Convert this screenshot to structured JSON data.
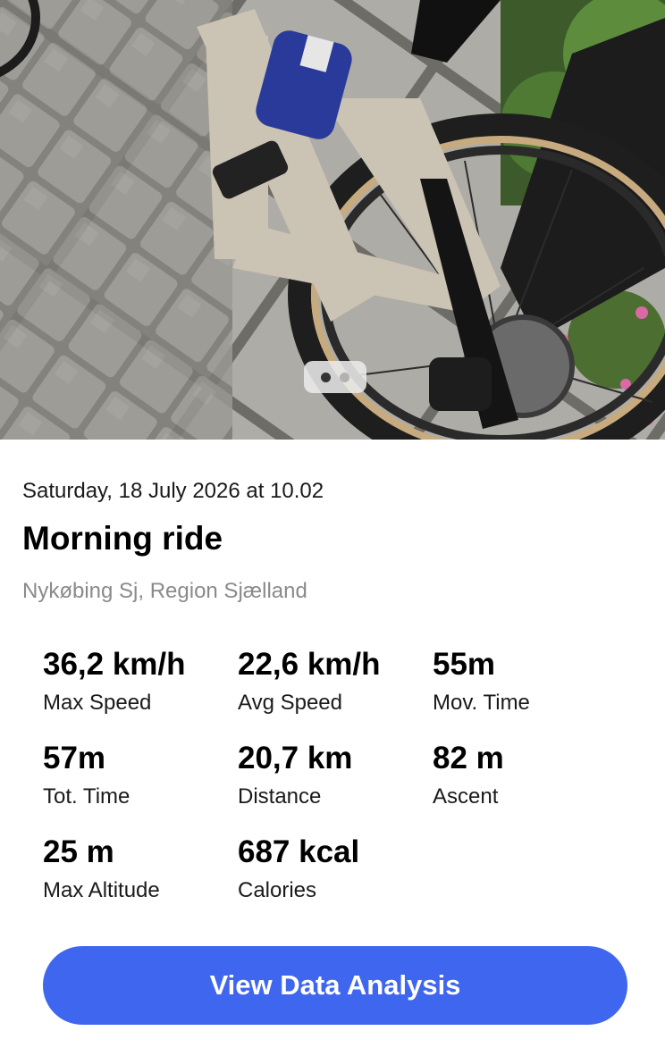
{
  "photo": {
    "alt_icon": "bicycle-photo",
    "pager": {
      "count": 2,
      "active_index": 0
    }
  },
  "activity": {
    "date_text": "Saturday, 18 July 2026 at 10.02",
    "title": "Morning ride",
    "location": "Nykøbing Sj, Region Sjælland"
  },
  "stats": [
    {
      "value": "36,2 km/h",
      "label": "Max Speed"
    },
    {
      "value": "22,6 km/h",
      "label": "Avg Speed"
    },
    {
      "value": "55m",
      "label": "Mov. Time"
    },
    {
      "value": "57m",
      "label": "Tot. Time"
    },
    {
      "value": "20,7 km",
      "label": "Distance"
    },
    {
      "value": "82 m",
      "label": "Ascent"
    },
    {
      "value": "25 m",
      "label": "Max Altitude"
    },
    {
      "value": "687 kcal",
      "label": "Calories"
    }
  ],
  "actions": {
    "view_analysis_label": "View Data Analysis"
  },
  "colors": {
    "accent": "#3f66ee",
    "secondary_text": "#8a8a8a"
  }
}
